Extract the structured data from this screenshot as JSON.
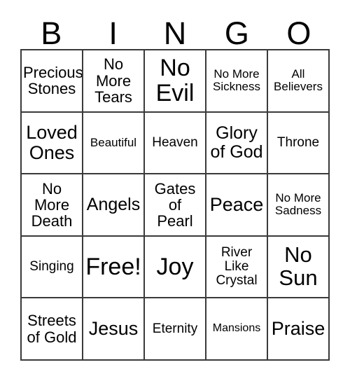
{
  "card": {
    "title": "Bingo Card",
    "columns": 5,
    "rows": 5,
    "colors": {
      "background": "#ffffff",
      "border": "#3a3a3a",
      "text": "#000000"
    }
  },
  "header": {
    "letters": [
      {
        "label": "B"
      },
      {
        "label": "I"
      },
      {
        "label": "N"
      },
      {
        "label": "G"
      },
      {
        "label": "O"
      }
    ]
  },
  "grid": {
    "rows": [
      {
        "cells": [
          {
            "text": "Precious\nStones",
            "size": "fs-lg"
          },
          {
            "text": "No\nMore\nTears",
            "size": "fs-lg"
          },
          {
            "text": "No\nEvil",
            "size": "fs-4xl"
          },
          {
            "text": "No More\nSickness",
            "size": "fs-sm"
          },
          {
            "text": "All\nBelievers",
            "size": "fs-sm"
          }
        ]
      },
      {
        "cells": [
          {
            "text": "Loved\nOnes",
            "size": "fs-2xl"
          },
          {
            "text": "Beautiful",
            "size": "fs-sm"
          },
          {
            "text": "Heaven",
            "size": "fs-md"
          },
          {
            "text": "Glory\nof God",
            "size": "fs-xl"
          },
          {
            "text": "Throne",
            "size": "fs-md"
          }
        ]
      },
      {
        "cells": [
          {
            "text": "No\nMore\nDeath",
            "size": "fs-lg"
          },
          {
            "text": "Angels",
            "size": "fs-xl"
          },
          {
            "text": "Gates\nof\nPearl",
            "size": "fs-lg"
          },
          {
            "text": "Peace",
            "size": "fs-2xl"
          },
          {
            "text": "No More\nSadness",
            "size": "fs-sm"
          }
        ]
      },
      {
        "cells": [
          {
            "text": "Singing",
            "size": "fs-md"
          },
          {
            "text": "Free!",
            "size": "fs-4xl"
          },
          {
            "text": "Joy",
            "size": "fs-4xl"
          },
          {
            "text": "River\nLike\nCrystal",
            "size": "fs-md"
          },
          {
            "text": "No\nSun",
            "size": "fs-3xl"
          }
        ]
      },
      {
        "cells": [
          {
            "text": "Streets\nof Gold",
            "size": "fs-lg"
          },
          {
            "text": "Jesus",
            "size": "fs-2xl"
          },
          {
            "text": "Eternity",
            "size": "fs-md"
          },
          {
            "text": "Mansions",
            "size": "fs-xs"
          },
          {
            "text": "Praise",
            "size": "fs-2xl"
          }
        ]
      }
    ]
  }
}
